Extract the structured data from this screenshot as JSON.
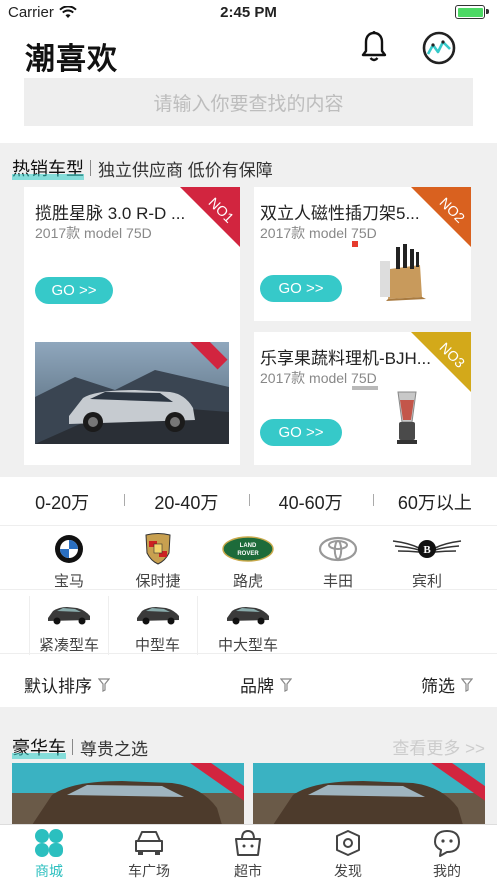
{
  "status_bar": {
    "carrier": "Carrier",
    "time": "2:45 PM"
  },
  "header": {
    "title": "潮喜欢",
    "bell_icon": "bell-icon",
    "scan_icon": "chart-circle-icon"
  },
  "search": {
    "placeholder": "请输入你要查找的内容"
  },
  "hot": {
    "title": "热销车型",
    "subtitle": "独立供应商 低价有保障",
    "cards": [
      {
        "name": "揽胜星脉 3.0 R-D ...",
        "model": "2017款 model 75D",
        "go": "GO >>",
        "rank": "NO1",
        "rank_color": "#d2253f"
      },
      {
        "name": "双立人磁性插刀架5...",
        "model": "2017款 model 75D",
        "go": "GO >>",
        "rank": "NO2",
        "rank_color": "#d9611f"
      },
      {
        "name": "乐享果蔬料理机-BJH...",
        "model": "2017款 model 75D",
        "go": "GO >>",
        "rank": "NO3",
        "rank_color": "#d3a91a"
      }
    ]
  },
  "prices": [
    "0-20万",
    "20-40万",
    "40-60万",
    "60万以上"
  ],
  "brands": [
    "宝马",
    "保时捷",
    "路虎",
    "丰田",
    "宾利"
  ],
  "car_types": [
    "紧凑型车",
    "中型车",
    "中大型车"
  ],
  "sort": {
    "default": "默认排序",
    "brand": "品牌",
    "filter": "筛选"
  },
  "luxury": {
    "title": "豪华车",
    "subtitle": "尊贵之选",
    "more": "查看更多 >>"
  },
  "tabs": [
    {
      "label": "商城",
      "icon": "mall-icon",
      "active": true
    },
    {
      "label": "车广场",
      "icon": "car-icon",
      "active": false
    },
    {
      "label": "超市",
      "icon": "basket-icon",
      "active": false
    },
    {
      "label": "发现",
      "icon": "discover-icon",
      "active": false
    },
    {
      "label": "我的",
      "icon": "profile-icon",
      "active": false
    }
  ],
  "colors": {
    "accent": "#36c9c9",
    "tab_active": "#2bbfbf"
  }
}
